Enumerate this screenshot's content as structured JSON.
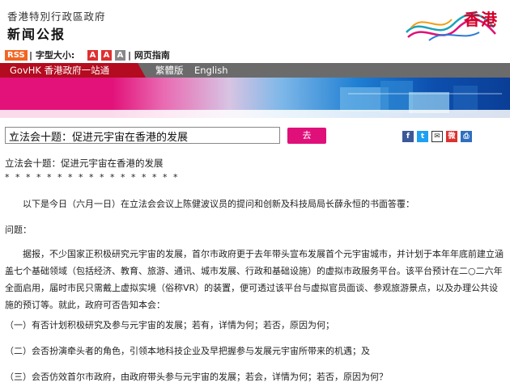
{
  "header": {
    "gov_name": "香港特別行政區政府",
    "site_title": "新闻公报",
    "logo_text": "香港"
  },
  "toolbar": {
    "rss": "RSS",
    "font_size_label": "| 字型大小:",
    "font_sizes": [
      "A",
      "A",
      "A"
    ],
    "text_only": "| 网页指南"
  },
  "nav": {
    "govhk": "GovHK 香港政府一站通",
    "trad": "繁體版",
    "english": "English"
  },
  "topic": {
    "selected": "立法会十题：促进元宇宙在香港的发展",
    "go_label": "去"
  },
  "share_icons": [
    "facebook-icon",
    "twitter-icon",
    "email-icon",
    "weibo-icon",
    "print-icon"
  ],
  "article": {
    "title": "立法会十题：促进元宇宙在香港的发展",
    "stars": "* * * * * * * * * * * * * * * * *",
    "intro": "以下是今日（六月一日）在立法会会议上陈健波议员的提问和创新及科技局局长薛永恒的书面答覆：",
    "question_label": "问题：",
    "body": "据报，不少国家正积极研究元宇宙的发展，首尔市政府更于去年带头宣布发展首个元宇宙城市，并计划于本年年底前建立涵盖七个基础领域（包括经济、教育、旅游、通讯、城市发展、行政和基础设施）的虚拟市政服务平台。该平台预计在二○二六年全面启用，届时市民只需戴上虚拟实境（俗称VR）的装置，便可透过该平台与虚拟官员面谈、参观旅游景点，以及办理公共设施的预订等。就此，政府可否告知本会：",
    "q1": "（一）有否计划积极研究及参与元宇宙的发展；若有，详情为何；若否，原因为何；",
    "q2": "（二）会否扮演牵头者的角色，引领本地科技企业及早把握参与发展元宇宙所带来的机遇；及",
    "q3": "（三）会否仿效首尔市政府，由政府带头参与元宇宙的发展；若会，详情为何；若否，原因为何？"
  },
  "colors": {
    "magenta": "#e0107a",
    "red": "#b30b1f",
    "rss": "#f26522"
  }
}
